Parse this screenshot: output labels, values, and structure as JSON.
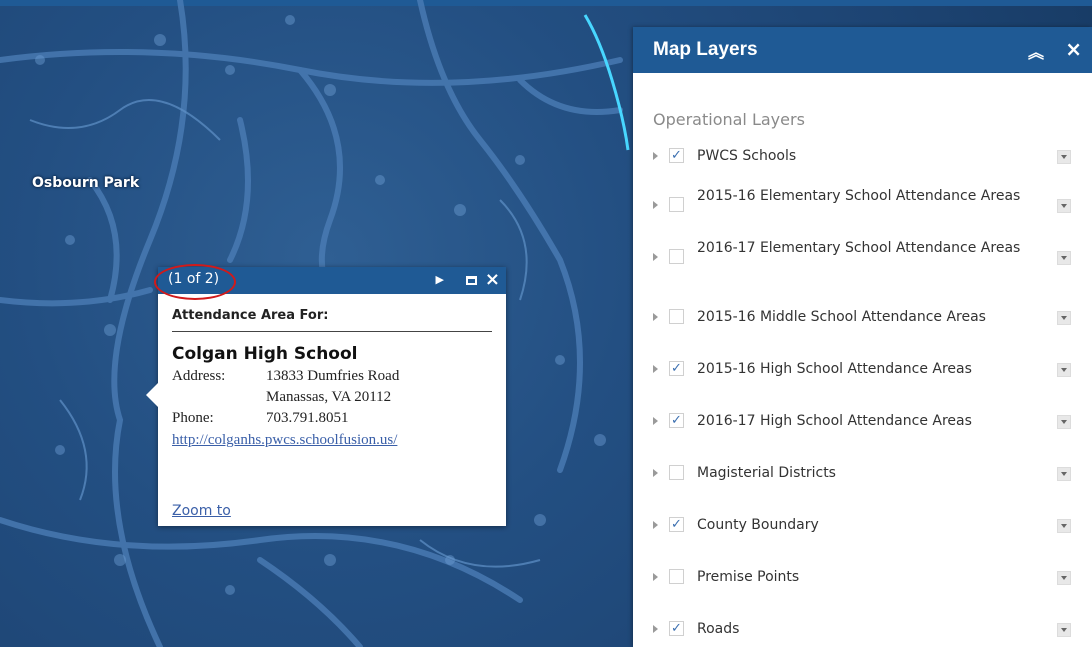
{
  "map": {
    "place_label": "Osbourn Park"
  },
  "popup": {
    "count": "(1 of 2)",
    "title": "Attendance Area For:",
    "school_name": "Colgan High School",
    "address_label": "Address:",
    "address_line1": "13833 Dumfries Road",
    "address_line2": "Manassas, VA 20112",
    "phone_label": "Phone:",
    "phone": "703.791.8051",
    "url": "http://colganhs.pwcs.schoolfusion.us/",
    "zoom_link": "Zoom to"
  },
  "panel": {
    "title": "Map Layers",
    "collapse_icon": "double-chevron-up-icon",
    "close_icon": "close-icon",
    "section_label": "Operational Layers",
    "layers": [
      {
        "label": "PWCS Schools",
        "checked": true
      },
      {
        "label": "2015-16 Elementary School Attendance Areas",
        "checked": false
      },
      {
        "label": "2016-17 Elementary School Attendance Areas",
        "checked": false
      },
      {
        "label": "2015-16 Middle School Attendance Areas",
        "checked": false
      },
      {
        "label": "2015-16 High School Attendance Areas",
        "checked": true
      },
      {
        "label": "2016-17 High School Attendance Areas",
        "checked": true
      },
      {
        "label": "Magisterial Districts",
        "checked": false
      },
      {
        "label": "County Boundary",
        "checked": true
      },
      {
        "label": "Premise Points",
        "checked": false
      },
      {
        "label": "Roads",
        "checked": true
      }
    ]
  },
  "colors": {
    "header_blue": "#1f5a95",
    "map_blue": "#234f82",
    "highlight_red": "#d11a1a",
    "link_blue": "#3a5fa8"
  }
}
